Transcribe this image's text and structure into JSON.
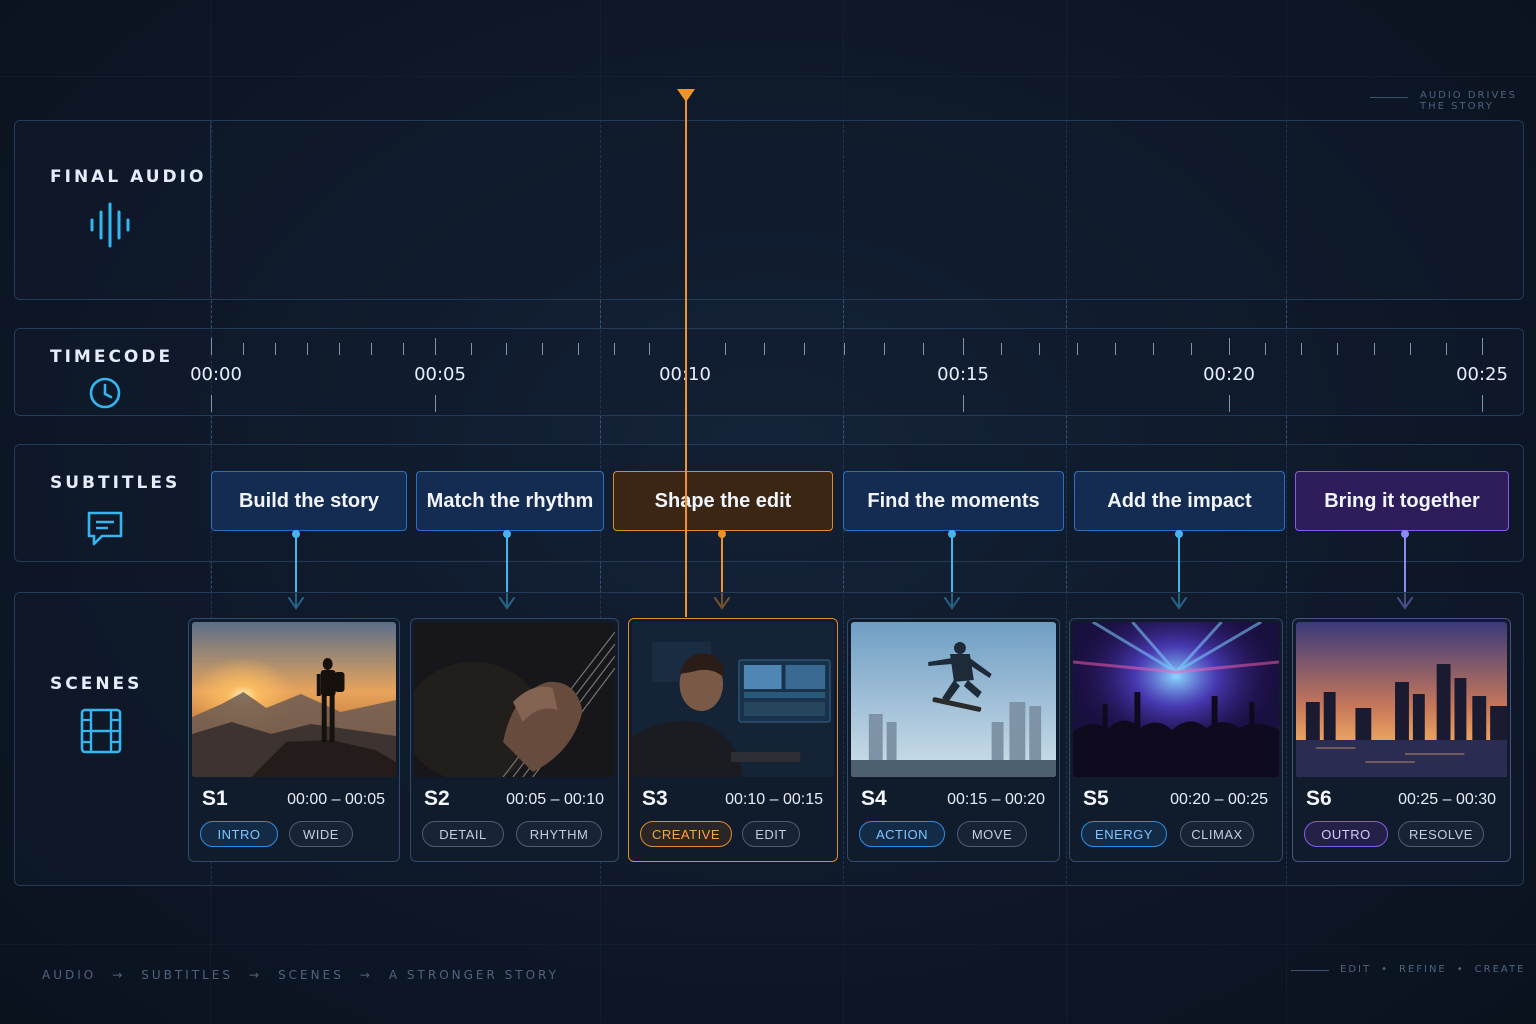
{
  "corner_note": {
    "line1": "AUDIO DRIVES",
    "line2": "THE STORY"
  },
  "rows": {
    "audio": "FINAL AUDIO",
    "timecode": "TIMECODE",
    "subtitles": "SUBTITLES",
    "scenes": "SCENES"
  },
  "icons": {
    "audio": "waveform-icon",
    "timecode": "clock-icon",
    "subtitles": "speech-bubble-icon",
    "scenes": "film-strip-icon"
  },
  "colors": {
    "accent_blue": "#2d8ee0",
    "playhead_orange": "#f0932b",
    "accent_purple": "#8a5ae6",
    "wave_start": "#1fb6ff",
    "wave_end": "#9b5cf5"
  },
  "timecodes": [
    "00:00",
    "00:05",
    "00:10",
    "00:15",
    "00:20",
    "00:25"
  ],
  "subtitles": [
    {
      "text": "Build the story"
    },
    {
      "text": "Match the rhythm"
    },
    {
      "text": "Shape the edit"
    },
    {
      "text": "Find the moments"
    },
    {
      "text": "Add the impact"
    },
    {
      "text": "Bring it together"
    }
  ],
  "scenes": [
    {
      "id": "S1",
      "range": "00:00 – 00:05",
      "tags": [
        "INTRO",
        "WIDE"
      ],
      "image": "hiker-on-mountain-sunset"
    },
    {
      "id": "S2",
      "range": "00:05 – 00:10",
      "tags": [
        "DETAIL",
        "RHYTHM"
      ],
      "image": "guitar-strings-closeup"
    },
    {
      "id": "S3",
      "range": "00:10 – 00:15",
      "tags": [
        "CREATIVE",
        "EDIT"
      ],
      "image": "editor-at-monitors"
    },
    {
      "id": "S4",
      "range": "00:15 – 00:20",
      "tags": [
        "ACTION",
        "MOVE"
      ],
      "image": "skateboard-jump-city"
    },
    {
      "id": "S5",
      "range": "00:20 – 00:25",
      "tags": [
        "ENERGY",
        "CLIMAX"
      ],
      "image": "concert-crowd-lights"
    },
    {
      "id": "S6",
      "range": "00:25 – 00:30",
      "tags": [
        "OUTRO",
        "RESOLVE"
      ],
      "image": "city-skyline-dusk"
    }
  ],
  "footer_left": [
    "AUDIO",
    "→",
    "SUBTITLES",
    "→",
    "SCENES",
    "→",
    "A STRONGER STORY"
  ],
  "footer_right": [
    "EDIT",
    "•",
    "REFINE",
    "•",
    "CREATE"
  ]
}
